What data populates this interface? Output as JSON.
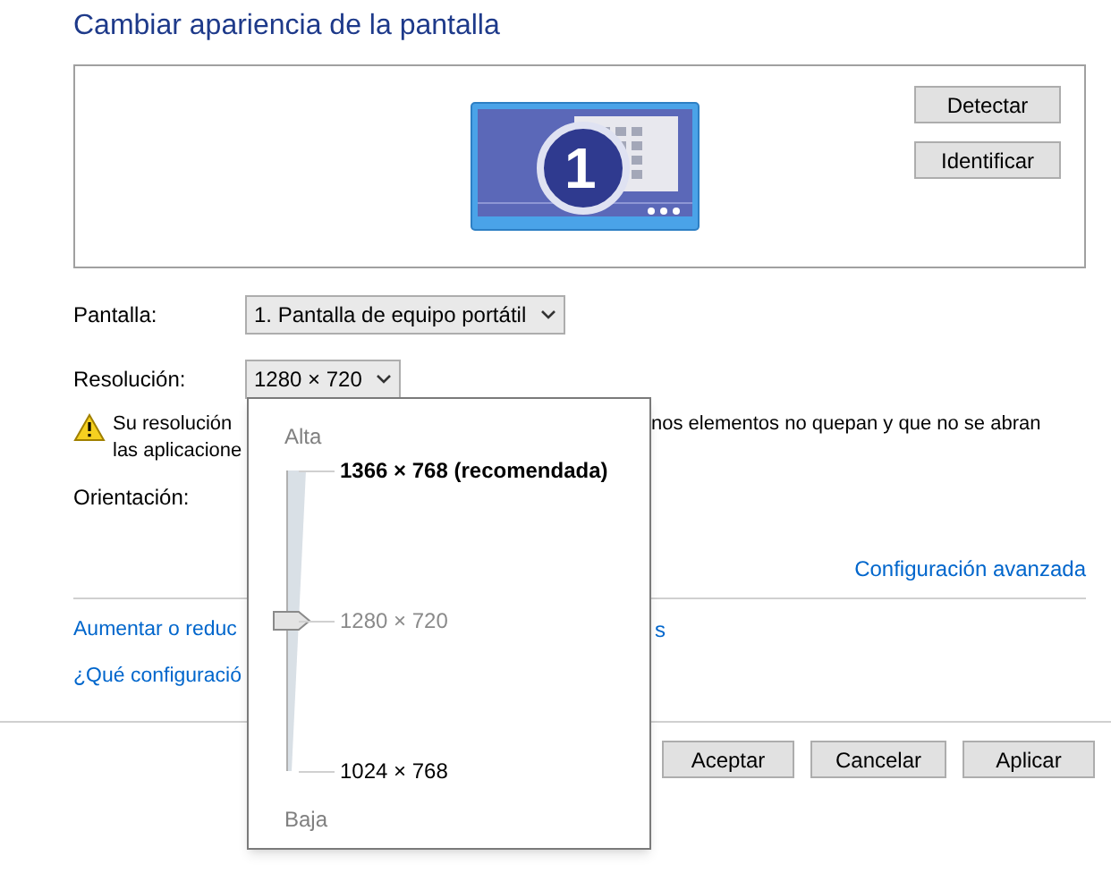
{
  "title": "Cambiar apariencia de la pantalla",
  "monitor": {
    "number": "1",
    "buttons": [
      "Detectar",
      "Identificar"
    ]
  },
  "fields": [
    {
      "label": "Pantalla:",
      "value": "1. Pantalla de equipo portátil"
    },
    {
      "label": "Resolución:",
      "value": "1280 × 720"
    }
  ],
  "warning": {
    "line1_start": "Su resolución",
    "line1_end": "nos elementos no quepan y que no se abran",
    "line2_start": "las aplicacione"
  },
  "orientation_label": "Orientación:",
  "advanced_link": "Configuración avanzada",
  "links": [
    {
      "start": "Aumentar o reduc",
      "end": "s"
    },
    {
      "start": "¿Qué configuració"
    }
  ],
  "buttons": [
    "Aceptar",
    "Cancelar",
    "Aplicar"
  ],
  "resolution_popup": {
    "top_label": "Alta",
    "bottom_label": "Baja",
    "level": 0.5,
    "options": [
      {
        "label": "1366 × 768 (recomendada)",
        "recommended": true,
        "selected": false
      },
      {
        "label": "1280 × 720",
        "recommended": false,
        "selected": true
      },
      {
        "label": "1024 × 768",
        "recommended": false,
        "selected": false
      }
    ]
  }
}
